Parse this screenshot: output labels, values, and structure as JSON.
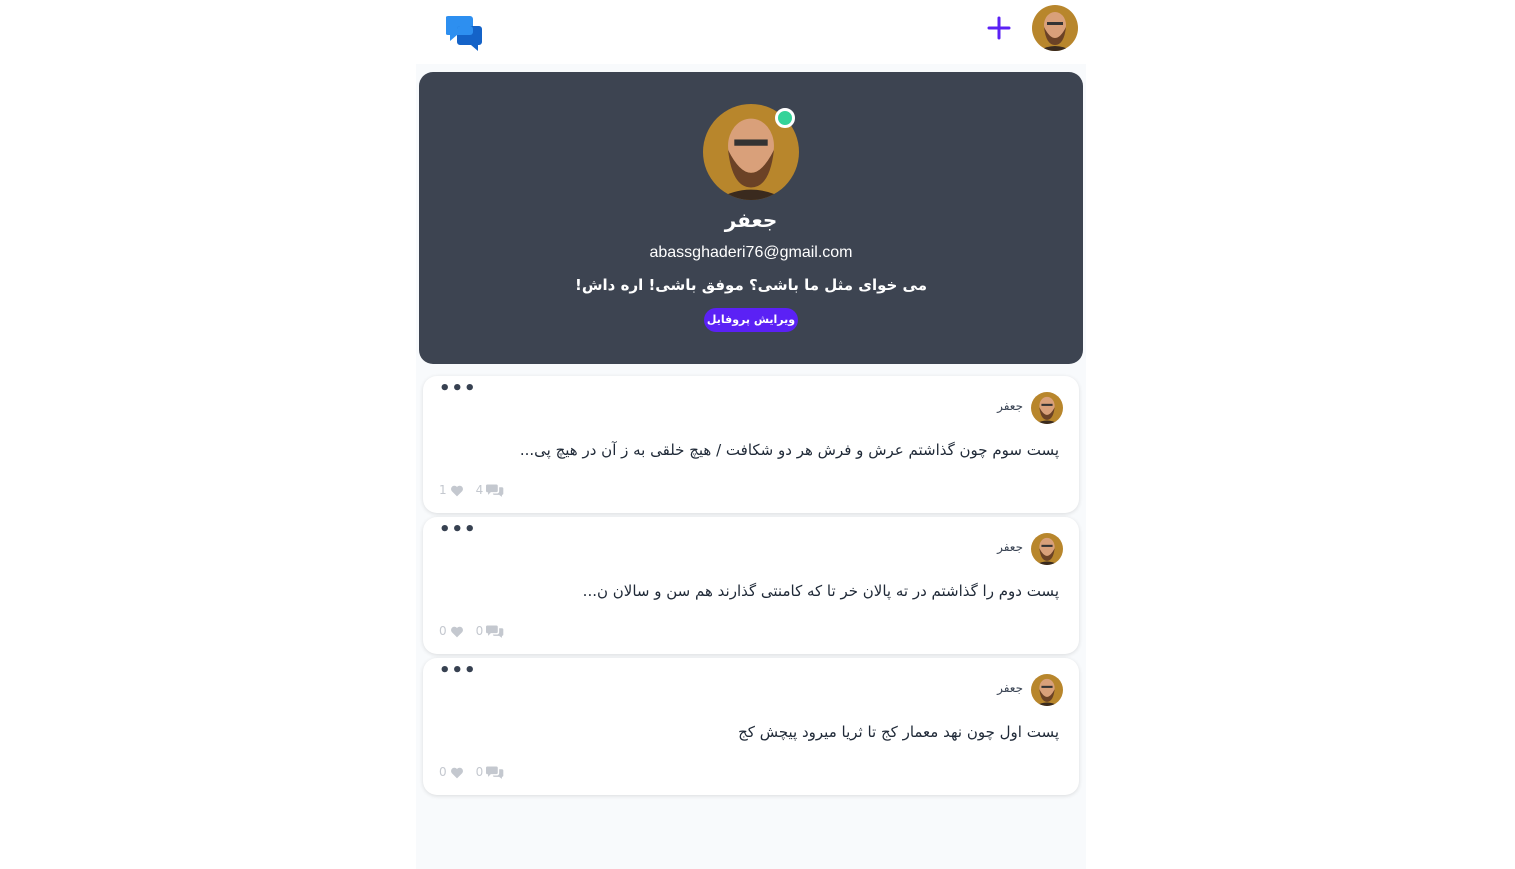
{
  "header": {
    "logo_icon": "chat-bubbles-icon",
    "add_icon": "plus-icon",
    "accent_color": "#5b21f5",
    "logo_color": "#1d8cf8"
  },
  "profile": {
    "name": "جعفر",
    "email": "abassghaderi76@gmail.com",
    "bio": "می خوای مثل ما باشی؟ موفق باشی! اره داش!",
    "edit_label": "ویرایش پروفایل",
    "online": true,
    "card_color": "#3d4451",
    "online_color": "#34d399"
  },
  "posts": [
    {
      "author": "جعفر",
      "text": "پست سوم چون گذاشتم عرش و فرش هر دو شکافت / هیچ خلقی به ز آن در هیچ پی...",
      "likes": "1",
      "comments": "4"
    },
    {
      "author": "جعفر",
      "text": "پست دوم را گذاشتم در ته پالان خر تا که کامنتی گذارند هم سن و سالان ن...",
      "likes": "0",
      "comments": "0"
    },
    {
      "author": "جعفر",
      "text": "پست اول چون نهد معمار کج تا ثریا میرود پیچش کج",
      "likes": "0",
      "comments": "0"
    }
  ]
}
